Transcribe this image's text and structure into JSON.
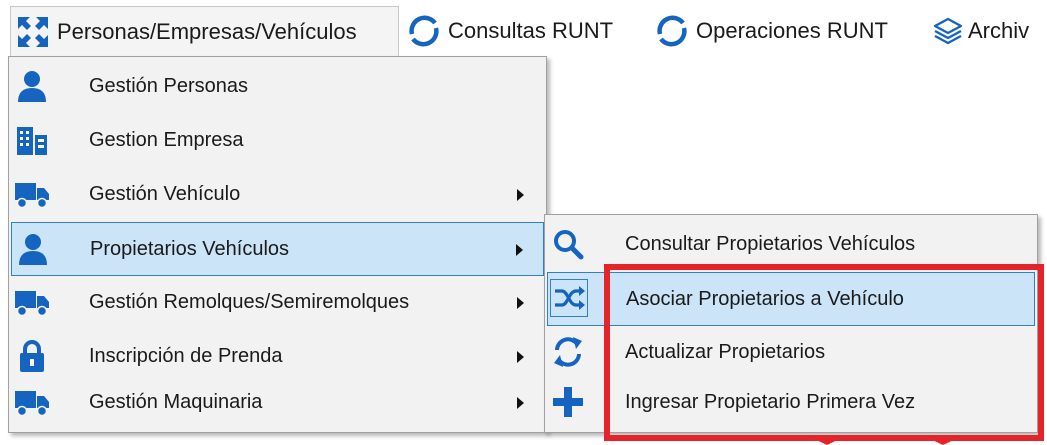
{
  "menubar": {
    "items": [
      {
        "label": "Personas/Empresas/Vehículos",
        "icon": "collapse-arrows-icon"
      },
      {
        "label": "Consultas RUNT",
        "icon": "sync-circle-icon"
      },
      {
        "label": "Operaciones RUNT",
        "icon": "sync-circle-icon"
      },
      {
        "label": "Archiv",
        "icon": "layers-icon"
      }
    ]
  },
  "main_menu": {
    "items": [
      {
        "label": "Gestión Personas",
        "icon": "person-icon",
        "has_submenu": false
      },
      {
        "label": "Gestion Empresa",
        "icon": "building-icon",
        "has_submenu": false
      },
      {
        "label": "Gestión Vehículo",
        "icon": "truck-icon",
        "has_submenu": true
      },
      {
        "label": "Propietarios Vehículos",
        "icon": "person-icon",
        "has_submenu": true,
        "highlighted": true
      },
      {
        "label": "Gestión Remolques/Semiremolques",
        "icon": "truck-icon",
        "has_submenu": true
      },
      {
        "label": "Inscripción de Prenda",
        "icon": "lock-icon",
        "has_submenu": true
      },
      {
        "label": "Gestión Maquinaria",
        "icon": "truck-icon",
        "has_submenu": true
      }
    ]
  },
  "submenu": {
    "items": [
      {
        "label": "Consultar Propietarios Vehículos",
        "icon": "search-icon"
      },
      {
        "label": "Asociar Propietarios a Vehículo",
        "icon": "shuffle-icon",
        "highlighted": true
      },
      {
        "label": "Actualizar Propietarios",
        "icon": "refresh-icon"
      },
      {
        "label": "Ingresar Propietario Primera Vez",
        "icon": "plus-icon"
      }
    ]
  },
  "colors": {
    "icon_blue": "#1565c0",
    "highlight_bg": "#cce4f7",
    "highlight_border": "#2f7fd0",
    "callout_red": "#e3242b",
    "menu_bg": "#f2f2f2"
  }
}
